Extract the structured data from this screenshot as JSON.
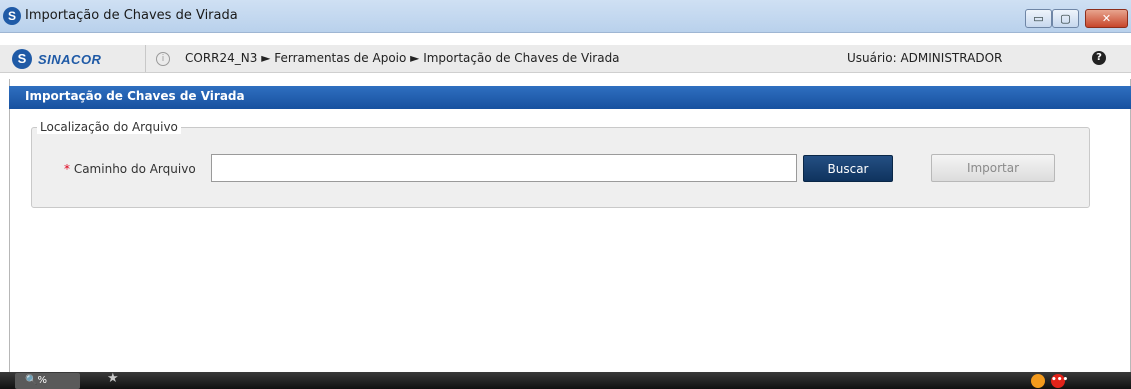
{
  "window": {
    "title": "Importação de Chaves de Virada",
    "minimize_glyph": "▭",
    "maximize_glyph": "▢",
    "close_glyph": "✕"
  },
  "navbar": {
    "logo_mark": "S",
    "logo_text": "SINACOR",
    "info_glyph": "i",
    "breadcrumb": "CORR24_N3 ► Ferramentas de Apoio ► Importação de Chaves de Virada",
    "user": "Usuário: ADMINISTRADOR",
    "help_glyph": "?"
  },
  "panel": {
    "title": "Importação de Chaves de Virada",
    "fieldset_legend": "Localização do Arquivo",
    "required_mark": "*",
    "path_label": "Caminho do Arquivo",
    "path_value": "",
    "buscar_label": "Buscar",
    "importar_label": "Importar"
  },
  "taskbar": {
    "search_text": "🔍%",
    "star_glyph": "★",
    "red_glyph": "•••"
  },
  "colors": {
    "panel_header": "#1e5aa8",
    "buscar_button": "#1a3f6b",
    "required": "#e0001b",
    "taskbar": "#1a1a1a"
  }
}
